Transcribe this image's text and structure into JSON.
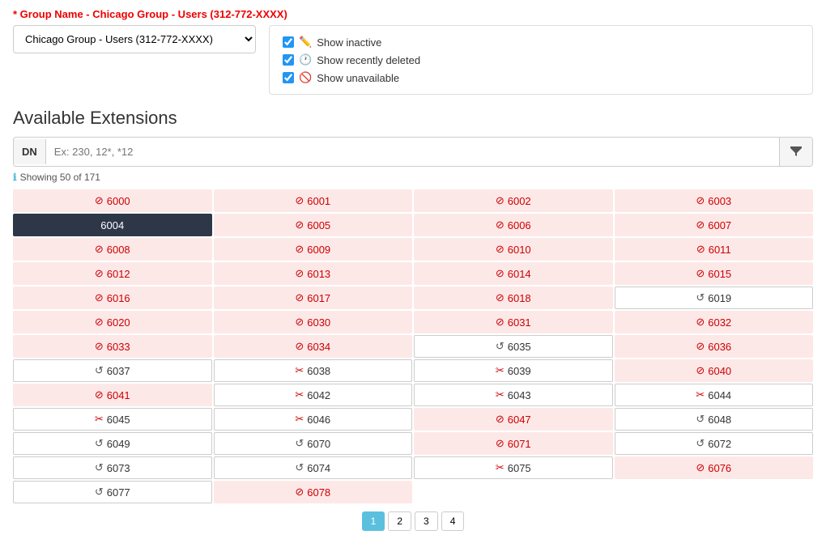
{
  "fieldLabel": "* Group Name - Chicago Group - Users (312-772-XXXX)",
  "dropdown": {
    "value": "Chicago Group - Users (312-772-XXXX)",
    "options": [
      "Chicago Group - Users (312-772-XXXX)"
    ]
  },
  "checkboxes": [
    {
      "id": "show-inactive",
      "icon": "✏️",
      "label": "Show inactive",
      "checked": true
    },
    {
      "id": "show-deleted",
      "icon": "🕐",
      "label": "Show recently deleted",
      "checked": true
    },
    {
      "id": "show-unavailable",
      "icon": "🚫",
      "label": "Show unavailable",
      "checked": true
    }
  ],
  "sectionTitle": "Available Extensions",
  "dnLabel": "DN",
  "searchPlaceholder": "Ex: 230, 12*, *12",
  "showingText": "Showing 50 of 171",
  "cells": [
    {
      "num": "6000",
      "type": "unavailable"
    },
    {
      "num": "6001",
      "type": "unavailable"
    },
    {
      "num": "6002",
      "type": "unavailable"
    },
    {
      "num": "6003",
      "type": "unavailable"
    },
    {
      "num": "6004",
      "type": "selected"
    },
    {
      "num": "6005",
      "type": "unavailable"
    },
    {
      "num": "6006",
      "type": "unavailable"
    },
    {
      "num": "6007",
      "type": "unavailable"
    },
    {
      "num": "6008",
      "type": "unavailable"
    },
    {
      "num": "6009",
      "type": "unavailable"
    },
    {
      "num": "6010",
      "type": "unavailable"
    },
    {
      "num": "6011",
      "type": "unavailable"
    },
    {
      "num": "6012",
      "type": "unavailable"
    },
    {
      "num": "6013",
      "type": "unavailable"
    },
    {
      "num": "6014",
      "type": "unavailable"
    },
    {
      "num": "6015",
      "type": "unavailable"
    },
    {
      "num": "6016",
      "type": "unavailable"
    },
    {
      "num": "6017",
      "type": "unavailable"
    },
    {
      "num": "6018",
      "type": "unavailable"
    },
    {
      "num": "6019",
      "type": "recently-deleted"
    },
    {
      "num": "6020",
      "type": "unavailable"
    },
    {
      "num": "6030",
      "type": "unavailable"
    },
    {
      "num": "6031",
      "type": "unavailable"
    },
    {
      "num": "6032",
      "type": "unavailable"
    },
    {
      "num": "6033",
      "type": "unavailable"
    },
    {
      "num": "6034",
      "type": "unavailable"
    },
    {
      "num": "6035",
      "type": "recently-deleted"
    },
    {
      "num": "6036",
      "type": "unavailable"
    },
    {
      "num": "6037",
      "type": "recently-deleted"
    },
    {
      "num": "6038",
      "type": "inactive"
    },
    {
      "num": "6039",
      "type": "inactive"
    },
    {
      "num": "6040",
      "type": "unavailable"
    },
    {
      "num": "6041",
      "type": "unavailable"
    },
    {
      "num": "6042",
      "type": "inactive"
    },
    {
      "num": "6043",
      "type": "inactive"
    },
    {
      "num": "6044",
      "type": "inactive"
    },
    {
      "num": "6045",
      "type": "inactive"
    },
    {
      "num": "6046",
      "type": "inactive"
    },
    {
      "num": "6047",
      "type": "unavailable"
    },
    {
      "num": "6048",
      "type": "recently-deleted"
    },
    {
      "num": "6049",
      "type": "recently-deleted"
    },
    {
      "num": "6070",
      "type": "recently-deleted"
    },
    {
      "num": "6071",
      "type": "unavailable"
    },
    {
      "num": "6072",
      "type": "recently-deleted"
    },
    {
      "num": "6073",
      "type": "recently-deleted"
    },
    {
      "num": "6074",
      "type": "recently-deleted"
    },
    {
      "num": "6075",
      "type": "inactive"
    },
    {
      "num": "6076",
      "type": "unavailable"
    },
    {
      "num": "6077",
      "type": "recently-deleted"
    },
    {
      "num": "6078",
      "type": "unavailable"
    }
  ],
  "pagination": {
    "pages": [
      "1",
      "2",
      "3",
      "4"
    ]
  }
}
